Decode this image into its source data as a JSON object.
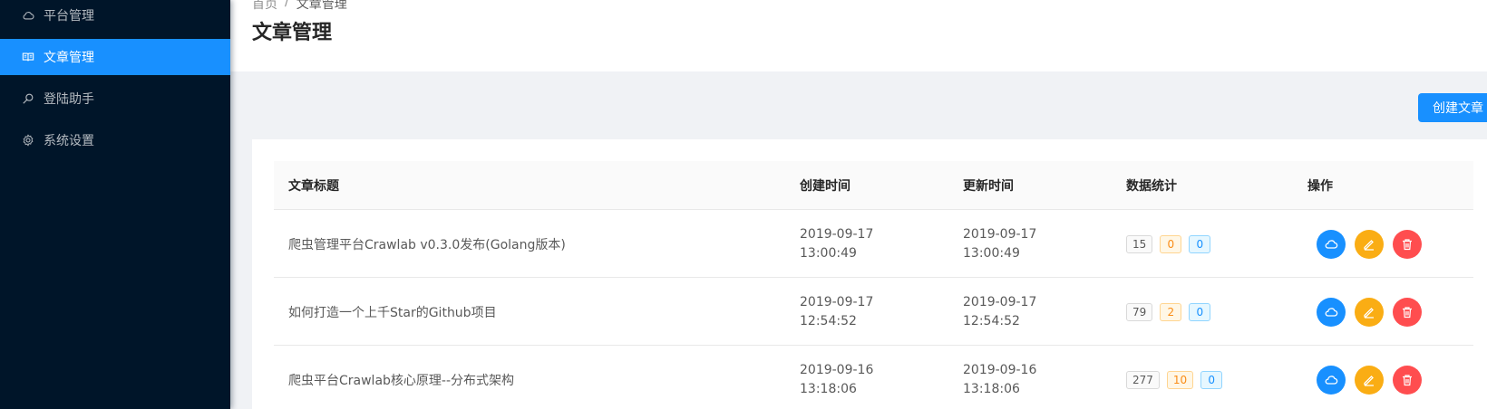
{
  "sidebar": {
    "items": [
      {
        "label": "平台管理",
        "icon": "cloud-icon",
        "active": false
      },
      {
        "label": "文章管理",
        "icon": "read-icon",
        "active": true
      },
      {
        "label": "登陆助手",
        "icon": "search-icon",
        "active": false
      },
      {
        "label": "系统设置",
        "icon": "gear-icon",
        "active": false
      }
    ]
  },
  "header": {
    "breadcrumb": [
      "首页",
      "/",
      "文章管理"
    ],
    "title": "文章管理"
  },
  "toolbar": {
    "create_label": "创建文章"
  },
  "table": {
    "columns": [
      "文章标题",
      "创建时间",
      "更新时间",
      "数据统计",
      "操作"
    ],
    "rows": [
      {
        "title": "爬虫管理平台Crawlab v0.3.0发布(Golang版本)",
        "created_date": "2019-09-17",
        "created_time": "13:00:49",
        "updated_date": "2019-09-17",
        "updated_time": "13:00:49",
        "views": "15",
        "likes": "0",
        "comments": "0"
      },
      {
        "title": "如何打造一个上千Star的Github项目",
        "created_date": "2019-09-17",
        "created_time": "12:54:52",
        "updated_date": "2019-09-17",
        "updated_time": "12:54:52",
        "views": "79",
        "likes": "2",
        "comments": "0"
      },
      {
        "title": "爬虫平台Crawlab核心原理--分布式架构",
        "created_date": "2019-09-16",
        "created_time": "13:18:06",
        "updated_date": "2019-09-16",
        "updated_time": "13:18:06",
        "views": "277",
        "likes": "10",
        "comments": "0"
      }
    ]
  },
  "colors": {
    "sidebar_bg": "#001529",
    "accent": "#1890ff",
    "warning": "#faad14",
    "danger": "#ff4d4f"
  }
}
